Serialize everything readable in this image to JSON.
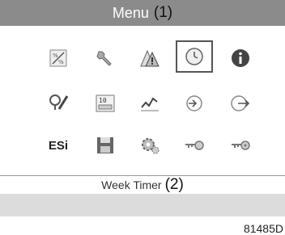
{
  "header": {
    "title": "Menu",
    "ref": "(1)"
  },
  "icons": [
    {
      "name": "percent-gauge-icon"
    },
    {
      "name": "wrench-icon"
    },
    {
      "name": "warning-triangles-icon"
    },
    {
      "name": "clock-icon",
      "selected": true
    },
    {
      "name": "info-icon"
    },
    {
      "name": "test-check-icon"
    },
    {
      "name": "counters-icon"
    },
    {
      "name": "trend-chart-icon"
    },
    {
      "name": "arrow-in-circle-icon"
    },
    {
      "name": "arrow-out-circle-icon"
    },
    {
      "name": "esi-label",
      "text": "ESi"
    },
    {
      "name": "save-disk-icon"
    },
    {
      "name": "gear-settings-icon"
    },
    {
      "name": "key-user-icon"
    },
    {
      "name": "key-service-icon"
    }
  ],
  "status": {
    "label": "Week Timer",
    "ref": "(2)"
  },
  "figure_code": "81485D"
}
